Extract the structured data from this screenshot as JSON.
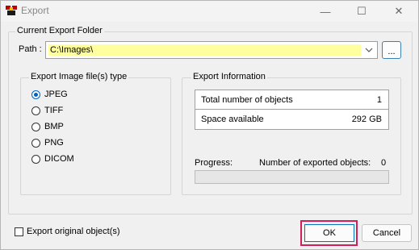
{
  "window": {
    "title": "Export"
  },
  "titlebar": {
    "minimize": "—",
    "maximize": "☐",
    "close": "✕"
  },
  "export_folder": {
    "legend": "Current Export Folder",
    "path_label": "Path :",
    "path_value": "C:\\Images\\",
    "browse_label": "..."
  },
  "file_type": {
    "legend": "Export Image file(s) type",
    "options": [
      "JPEG",
      "TIFF",
      "BMP",
      "PNG",
      "DICOM"
    ],
    "selected": "JPEG"
  },
  "export_info": {
    "legend": "Export Information",
    "rows": [
      {
        "label": "Total number of objects",
        "value": "1"
      },
      {
        "label": "Space available",
        "value": "292 GB"
      }
    ],
    "progress_label": "Progress:",
    "exported_label": "Number of exported objects:",
    "exported_count": "0",
    "progress_fraction": 0
  },
  "original_checkbox": {
    "label": "Export original object(s)",
    "checked": false
  },
  "buttons": {
    "ok": "OK",
    "cancel": "Cancel"
  },
  "colors": {
    "highlight": "#d0205a",
    "path_bg": "#ffff9e",
    "accent": "#0060c0"
  }
}
